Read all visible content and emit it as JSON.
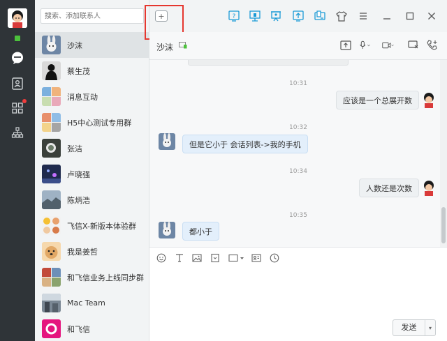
{
  "sidebar": {
    "nav": [
      "me-avatar",
      "chat-bubble-icon",
      "contacts-book-icon",
      "apps-grid-icon",
      "org-tree-icon"
    ]
  },
  "search": {
    "placeholder": "搜索、添加联系人"
  },
  "toolbar": {
    "new_chat_icon": "+",
    "icons": [
      "help-icon",
      "screen-share-icon",
      "presentation-icon",
      "upload-icon",
      "device-icon",
      "skin-shirt-icon",
      "menu-icon",
      "minimize-icon",
      "maximize-icon",
      "close-icon"
    ]
  },
  "contacts": [
    {
      "name": "沙沫",
      "active": true
    },
    {
      "name": "蔡生茂"
    },
    {
      "name": "消息互动"
    },
    {
      "name": "H5中心测试专用群"
    },
    {
      "name": "张洁"
    },
    {
      "name": "卢晓强"
    },
    {
      "name": "陈炳浩"
    },
    {
      "name": "飞信X-新版本体验群"
    },
    {
      "name": "我是姜哲"
    },
    {
      "name": "和飞信业务上线同步群"
    },
    {
      "name": "Mac Team"
    },
    {
      "name": "和飞信"
    }
  ],
  "chat": {
    "title": "沙沫",
    "messages": [
      {
        "time": "10:31",
        "text": "应该是一个总展开数",
        "from": "me"
      },
      {
        "time": "10:32",
        "text": "但是它小于 会话列表->我的手机",
        "from": "them"
      },
      {
        "time": "10:34",
        "text": "人数还是次数",
        "from": "me"
      },
      {
        "time": "10:35",
        "text": "都小于",
        "from": "them"
      }
    ]
  },
  "input": {
    "send_label": "发送",
    "dropdown": "▾"
  },
  "colors": {
    "rail": "#2f3438",
    "online": "#4cc23c",
    "badge": "#f03c3c",
    "accent": "#1a9ad6",
    "highlight": "#e5372f"
  }
}
